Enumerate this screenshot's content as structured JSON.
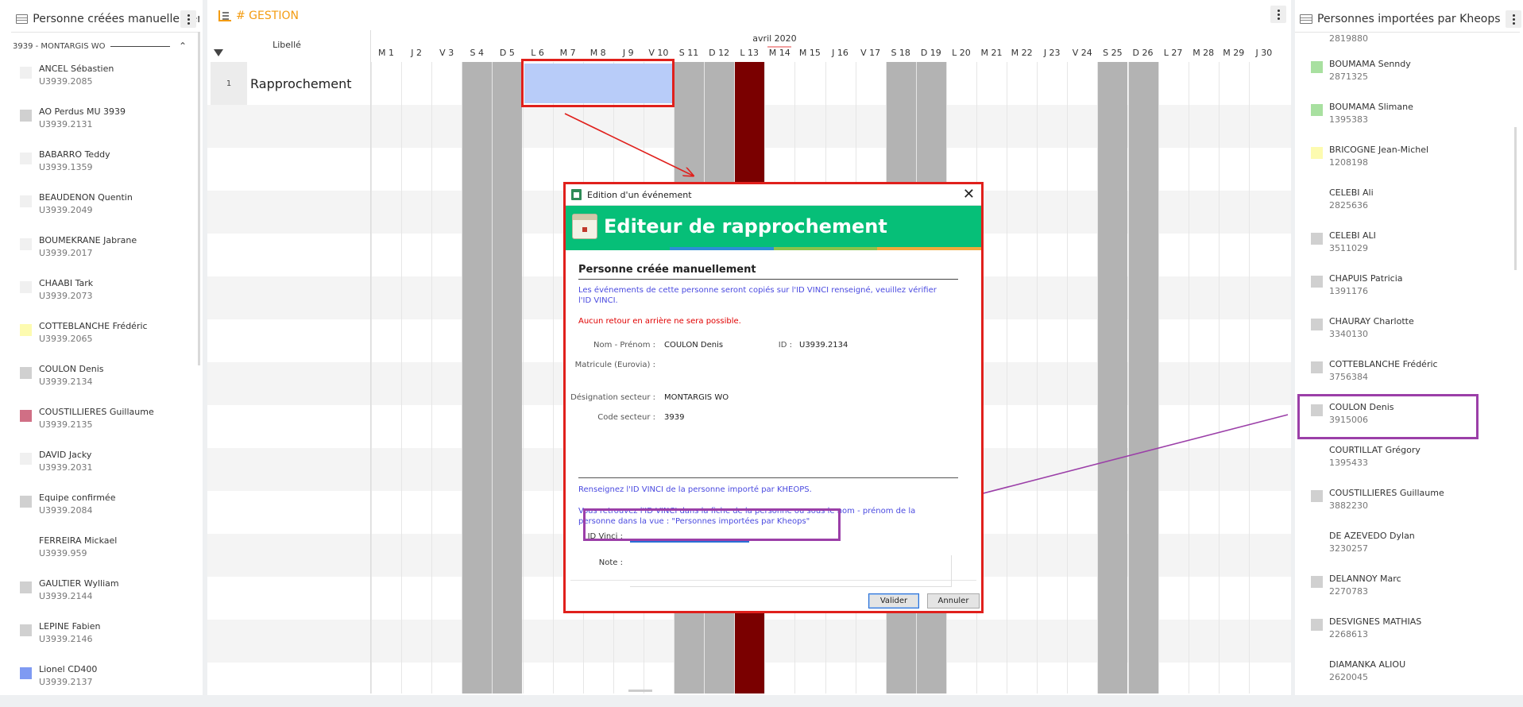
{
  "left_panel": {
    "title": "Personne créées manuellement",
    "group_label": "3939 - MONTARGIS WO",
    "persons": [
      {
        "name": "ANCEL Sébastien",
        "id": "U3939.2085",
        "color": "#f0f0f0"
      },
      {
        "name": "AO Perdus MU 3939",
        "id": "U3939.2131",
        "color": "#d0d0d0"
      },
      {
        "name": "BABARRO Teddy",
        "id": "U3939.1359",
        "color": "#f0f0f0"
      },
      {
        "name": "BEAUDENON Quentin",
        "id": "U3939.2049",
        "color": "#f0f0f0"
      },
      {
        "name": "BOUMEKRANE Jabrane",
        "id": "U3939.2017",
        "color": "#f0f0f0"
      },
      {
        "name": "CHAABI Tark",
        "id": "U3939.2073",
        "color": "#f0f0f0"
      },
      {
        "name": "COTTEBLANCHE Frédéric",
        "id": "U3939.2065",
        "color": "#fdfbb0"
      },
      {
        "name": "COULON Denis",
        "id": "U3939.2134",
        "color": "#d0d0d0"
      },
      {
        "name": "COUSTILLIERES Guillaume",
        "id": "U3939.2135",
        "color": "#d06f85"
      },
      {
        "name": "DAVID Jacky",
        "id": "U3939.2031",
        "color": "#f0f0f0"
      },
      {
        "name": "Equipe confirmée",
        "id": "U3939.2084",
        "color": "#d0d0d0"
      },
      {
        "name": "FERREIRA Mickael",
        "id": "U3939.959",
        "color": "#ffffff"
      },
      {
        "name": "GAULTIER Wylliam",
        "id": "U3939.2144",
        "color": "#d0d0d0"
      },
      {
        "name": "LEPINE Fabien",
        "id": "U3939.2146",
        "color": "#d0d0d0"
      },
      {
        "name": "Lionel CD400",
        "id": "U3939.2137",
        "color": "#7f9af2"
      }
    ]
  },
  "center_panel": {
    "title": "# GESTION",
    "libelle_header": "Libellé",
    "month": "avril 2020",
    "days": [
      "M 1",
      "J 2",
      "V 3",
      "S 4",
      "D 5",
      "L 6",
      "M 7",
      "M 8",
      "J 9",
      "V 10",
      "S 11",
      "D 12",
      "L 13",
      "M 14",
      "M 15",
      "J 16",
      "V 17",
      "S 18",
      "D 19",
      "L 20",
      "M 21",
      "M 22",
      "J 23",
      "V 24",
      "S 25",
      "D 26",
      "L 27",
      "M 28",
      "M 29",
      "J 30"
    ],
    "rows": [
      {
        "num": "1",
        "label": "Rapprochement"
      }
    ],
    "colors": {
      "weekend": "#b3b3b3",
      "holiday": "#7a0000",
      "event": "#b8ccf9"
    }
  },
  "right_panel": {
    "title": "Personnes importées par Kheops",
    "cut_top_id": "2819880",
    "persons": [
      {
        "name": "BOUMAMA Senndy",
        "id": "2871325",
        "color": "#a8e0a0"
      },
      {
        "name": "BOUMAMA Slimane",
        "id": "1395383",
        "color": "#a8e0a0"
      },
      {
        "name": "BRICOGNE Jean-Michel",
        "id": "1208198",
        "color": "#fdfbb0"
      },
      {
        "name": "CELEBI Ali",
        "id": "2825636",
        "color": "#ffffff"
      },
      {
        "name": "CELEBI ALI",
        "id": "3511029",
        "color": "#d0d0d0"
      },
      {
        "name": "CHAPUIS Patricia",
        "id": "1391176",
        "color": "#d0d0d0"
      },
      {
        "name": "CHAURAY Charlotte",
        "id": "3340130",
        "color": "#d0d0d0"
      },
      {
        "name": "COTTEBLANCHE Frédéric",
        "id": "3756384",
        "color": "#d0d0d0"
      },
      {
        "name": "COULON Denis",
        "id": "3915006",
        "color": "#d0d0d0"
      },
      {
        "name": "COURTILLAT Grégory",
        "id": "1395433",
        "color": "#ffffff"
      },
      {
        "name": "COUSTILLIERES Guillaume",
        "id": "3882230",
        "color": "#d0d0d0"
      },
      {
        "name": "DE AZEVEDO Dylan",
        "id": "3230257",
        "color": "#ffffff"
      },
      {
        "name": "DELANNOY Marc",
        "id": "2270783",
        "color": "#d0d0d0"
      },
      {
        "name": "DESVIGNES MATHIAS",
        "id": "2268613",
        "color": "#d0d0d0"
      },
      {
        "name": "DIAMANKA ALIOU",
        "id": "2620045",
        "color": "#ffffff"
      }
    ]
  },
  "dialog": {
    "window_title": "Edition d'un événement",
    "banner_title": "Editeur de rapprochement",
    "section_title": "Personne créée manuellement",
    "info_copy": "Les événements de cette personne seront copiés sur l'ID VINCI renseigné, veuillez vérifier l'ID VINCI.",
    "warning": "Aucun retour en arrière ne sera possible.",
    "fields": {
      "nom_label": "Nom - Prénom :",
      "nom_value": "COULON Denis",
      "id_label": "ID :",
      "id_value": "U3939.2134",
      "matricule_label": "Matricule (Eurovia) :",
      "matricule_value": "",
      "designation_label": "Désignation secteur :",
      "designation_value": "MONTARGIS WO",
      "code_label": "Code secteur :",
      "code_value": "3939"
    },
    "instruction1": "Renseignez l'ID VINCI de la personne importé par KHEOPS.",
    "instruction2": "Vous retrouvez l'ID VINCI dans la fiche de la personne ou sous le nom - prénom de la personne dans la vue : \"Personnes importées par Kheops\"",
    "id_vinci_label": "ID Vinci :",
    "id_vinci_value": "",
    "note_label": "Note :",
    "note_value": "",
    "validate_label": "Valider",
    "cancel_label": "Annuler",
    "stripe_colors": [
      "#06bf78",
      "#2c8fd6",
      "#8bc34a",
      "#f2a93b"
    ]
  },
  "annotations": {
    "red": "#e0201c",
    "purple": "#9b3fa8"
  }
}
